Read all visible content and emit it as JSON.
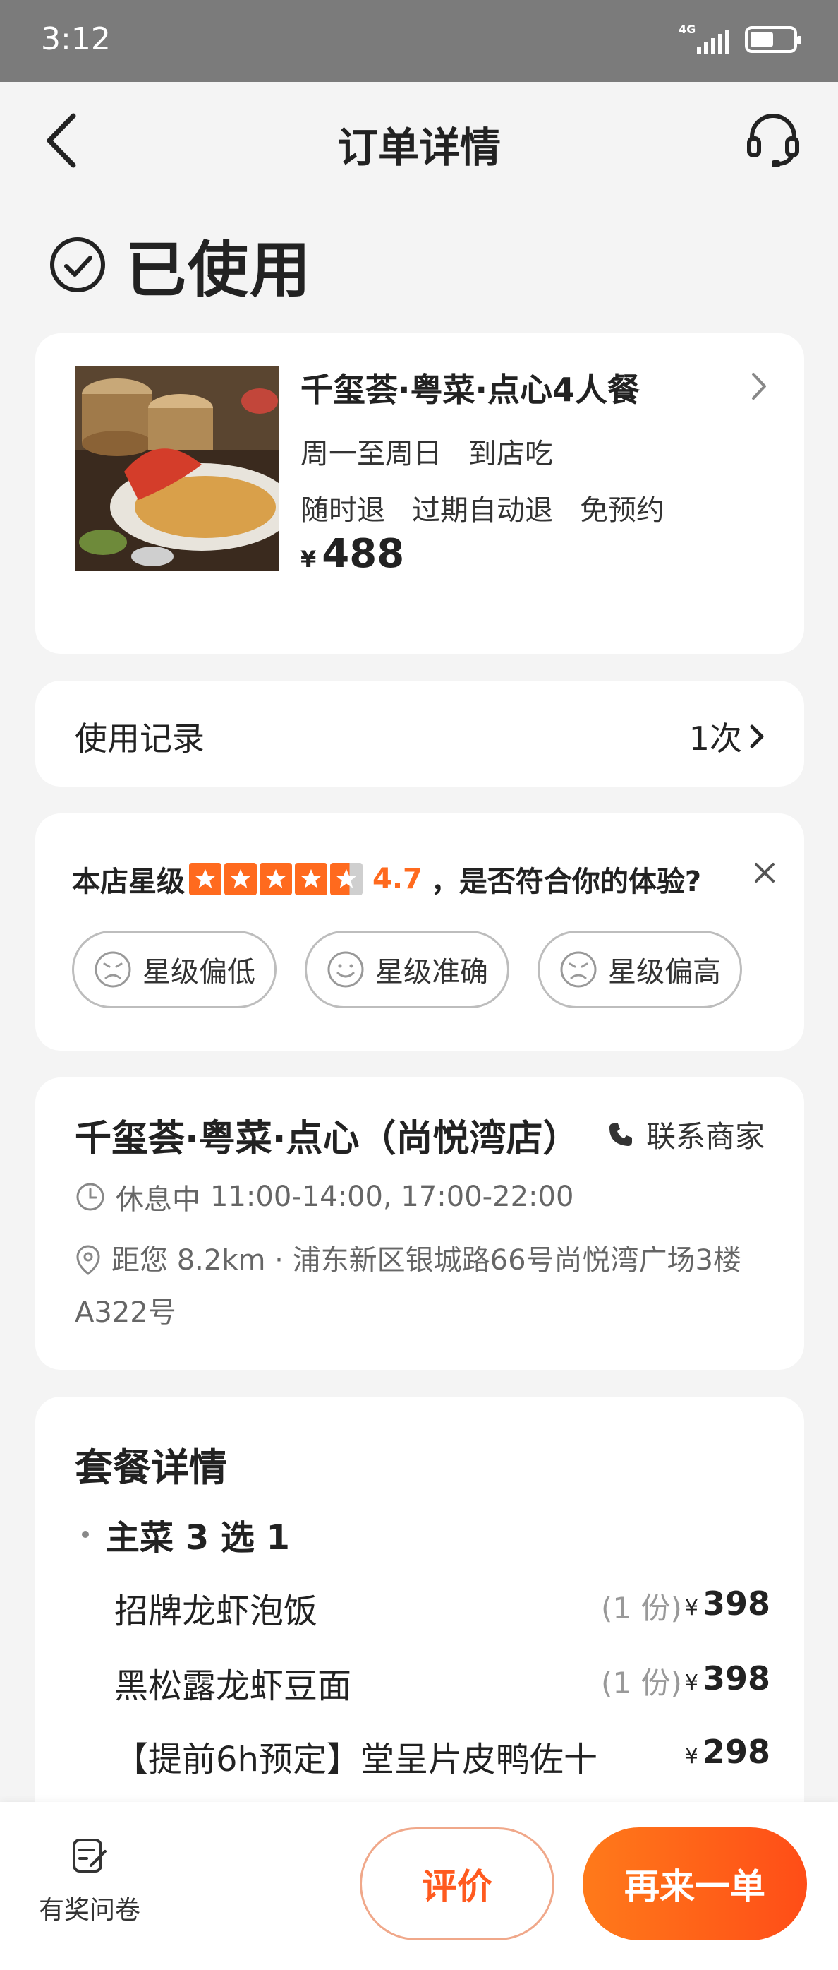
{
  "status_bar": {
    "time": "3:12",
    "network": "4G",
    "battery_level": 0.55
  },
  "nav": {
    "title": "订单详情",
    "back_icon": "chevron-left-icon",
    "service_icon": "headset-icon"
  },
  "order_status": {
    "icon": "check-circle-icon",
    "text": "已使用"
  },
  "deal": {
    "title": "千玺荟·粤菜·点心4人餐",
    "days": "周一至周日",
    "mode": "到店吃",
    "tags": [
      "随时退",
      "过期自动退",
      "免预约"
    ],
    "currency": "¥",
    "price": "488"
  },
  "usage_record": {
    "label": "使用记录",
    "count": "1次"
  },
  "rating": {
    "prefix": "本店星级",
    "stars": 4.7,
    "score": "4.7",
    "question": "，是否符合你的体验?",
    "options": [
      {
        "label": "星级偏低",
        "icon": "sad-face-icon"
      },
      {
        "label": "星级准确",
        "icon": "smile-face-icon"
      },
      {
        "label": "星级偏高",
        "icon": "sad-face-icon"
      }
    ]
  },
  "shop": {
    "name": "千玺荟·粤菜·点心（尚悦湾店）",
    "contact_label": "联系商家",
    "status": "休息中",
    "hours": "11:00-14:00, 17:00-22:00",
    "distance": "距您 8.2km",
    "address": "浦东新区银城路66号尚悦湾广场3楼A322号"
  },
  "package": {
    "title": "套餐详情",
    "group": "主菜 3 选 1",
    "items": [
      {
        "name": "招牌龙虾泡饭",
        "qty": "(1 份)",
        "price": "398"
      },
      {
        "name": "黑松露龙虾豆面",
        "qty": "(1 份)",
        "price": "398"
      },
      {
        "name": "【提前6h预定】堂呈片皮鸭佐十",
        "qty": "",
        "price": "298"
      }
    ]
  },
  "bottom": {
    "survey_label": "有奖问卷",
    "review_label": "评价",
    "reorder_label": "再来一单"
  },
  "colors": {
    "accent": "#ff5a1f",
    "status_bar": "#7b7b7b",
    "background": "#f4f4f4"
  }
}
